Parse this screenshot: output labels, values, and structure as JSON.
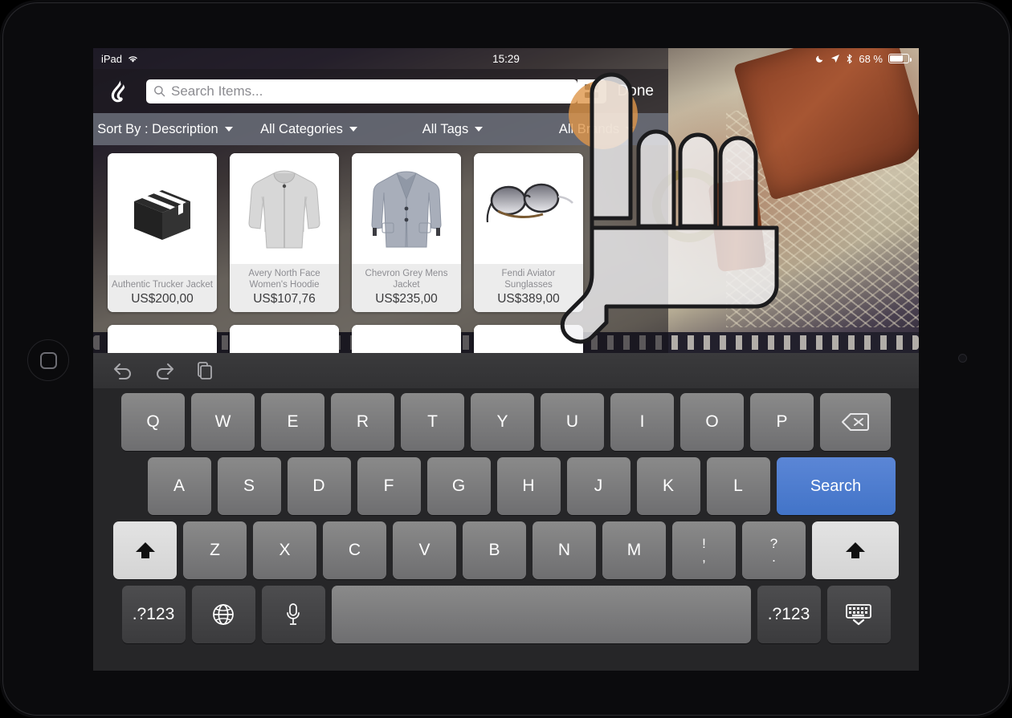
{
  "device": {
    "name": "iPad",
    "home_button": "home-button"
  },
  "status_bar": {
    "carrier_label": "iPad",
    "wifi_icon": "wifi-icon",
    "time": "15:29",
    "dnd_icon": "moon-icon",
    "location_icon": "location-arrow-icon",
    "bluetooth_icon": "bluetooth-icon",
    "battery_percent": "68 %",
    "battery_icon": "battery-icon"
  },
  "navbar": {
    "logo_icon": "lightspeed-logo-icon",
    "search_placeholder": "Search Items...",
    "search_value": "",
    "search_icon": "search-icon",
    "grid_icon": "grid-view-icon",
    "done_label": "Done"
  },
  "filters": [
    {
      "label": "Sort By : Description",
      "icon": "chevron-down-icon"
    },
    {
      "label": "All Categories",
      "icon": "chevron-down-icon"
    },
    {
      "label": "All Tags",
      "icon": "chevron-down-icon"
    },
    {
      "label": "All Brands",
      "icon": "chevron-down-icon"
    }
  ],
  "products": [
    {
      "name": "Authentic Trucker Jacket",
      "price": "US$200,00",
      "image": "box-placeholder-icon"
    },
    {
      "name": "Avery North Face Women's Hoodie",
      "price": "US$107,76",
      "image": "grey-hoodie-image"
    },
    {
      "name": "Chevron Grey Mens Jacket",
      "price": "US$235,00",
      "image": "grey-blazer-image"
    },
    {
      "name": "Fendi Aviator Sunglasses",
      "price": "US$389,00",
      "image": "aviator-sunglasses-image"
    }
  ],
  "keyboard": {
    "toolbar": [
      {
        "icon": "undo-icon"
      },
      {
        "icon": "redo-icon"
      },
      {
        "icon": "paste-icon"
      }
    ],
    "row1": [
      "Q",
      "W",
      "E",
      "R",
      "T",
      "Y",
      "U",
      "I",
      "O",
      "P"
    ],
    "row1_extra": {
      "label": "",
      "icon": "backspace-icon"
    },
    "row2": [
      "A",
      "S",
      "D",
      "F",
      "G",
      "H",
      "J",
      "K",
      "L"
    ],
    "row2_extra": {
      "label": "Search"
    },
    "row3_shift_left": {
      "icon": "shift-up-arrow-icon"
    },
    "row3": [
      "Z",
      "X",
      "C",
      "V",
      "B",
      "N",
      "M"
    ],
    "row3_punct": [
      {
        "top": "!",
        "bottom": ","
      },
      {
        "top": "?",
        "bottom": "."
      }
    ],
    "row3_shift_right": {
      "icon": "shift-up-arrow-icon"
    },
    "row4_left_num": ".?123",
    "row4_globe": {
      "icon": "globe-icon"
    },
    "row4_mic": {
      "icon": "microphone-icon"
    },
    "row4_space": "",
    "row4_right_num": ".?123",
    "row4_hide": {
      "icon": "hide-keyboard-icon"
    }
  },
  "overlay": {
    "touch_indicator": "touch-point-indicator",
    "hand_cursor": "hand-cursor-overlay"
  },
  "colors": {
    "accent_blue": "#4274c8",
    "touch_orange": "#de964a",
    "filter_bar": "#656873",
    "keyboard_bg": "#262628"
  }
}
